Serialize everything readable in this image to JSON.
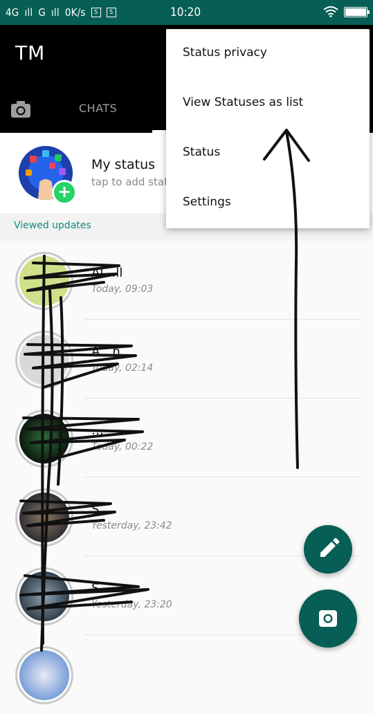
{
  "status_bar": {
    "left_text": "4Gₐₐₐ Gₐₐₐ 0K/s",
    "net_label": "4G",
    "net2_label": "G",
    "speed": "0K/s",
    "badge1": "S",
    "badge2": "S",
    "time": "10:20",
    "battery_level": 1.0
  },
  "app": {
    "title": "TM"
  },
  "tabs": {
    "camera_icon": "camera-icon",
    "chats_label": "CHATS"
  },
  "my_status": {
    "name": "My status",
    "subtitle": "tap to add stat"
  },
  "section": {
    "label": "Viewed updates"
  },
  "statuses": [
    {
      "name": "Al…ll",
      "time": "Today, 09:03"
    },
    {
      "name": "A…n",
      "time": "Today, 02:14"
    },
    {
      "name": "…",
      "time": "Today, 00:22"
    },
    {
      "name": "S…",
      "time": "Yesterday, 23:42"
    },
    {
      "name": "S…",
      "time": "Yesterday, 23:20"
    }
  ],
  "menu": {
    "items": [
      "Status privacy",
      "View Statuses as list",
      "Status",
      "Settings"
    ]
  },
  "fabs": {
    "edit_icon": "pencil-icon",
    "camera_icon": "camera-icon"
  },
  "colors": {
    "primary": "#075e54",
    "accent": "#25d366",
    "link": "#128c7e"
  }
}
